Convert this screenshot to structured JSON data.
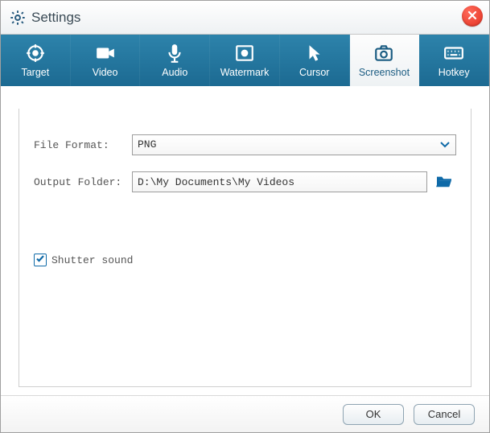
{
  "window": {
    "title": "Settings"
  },
  "tabs": [
    {
      "label": "Target"
    },
    {
      "label": "Video"
    },
    {
      "label": "Audio"
    },
    {
      "label": "Watermark"
    },
    {
      "label": "Cursor"
    },
    {
      "label": "Screenshot"
    },
    {
      "label": "Hotkey"
    }
  ],
  "active_tab": "Screenshot",
  "form": {
    "file_format_label": "File Format:",
    "file_format_value": "PNG",
    "output_folder_label": "Output Folder:",
    "output_folder_value": "D:\\My Documents\\My Videos",
    "shutter_sound_label": "Shutter sound",
    "shutter_sound_checked": true
  },
  "buttons": {
    "ok": "OK",
    "cancel": "Cancel"
  }
}
